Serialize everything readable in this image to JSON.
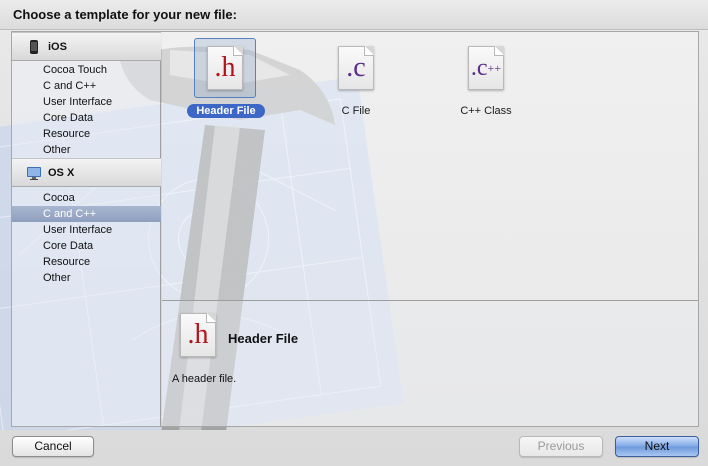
{
  "dialog": {
    "title": "Choose a template for your new file:"
  },
  "sidebar": {
    "sections": [
      {
        "label": "iOS",
        "icon": "iphone-icon",
        "items": [
          "Cocoa Touch",
          "C and C++",
          "User Interface",
          "Core Data",
          "Resource",
          "Other"
        ]
      },
      {
        "label": "OS X",
        "icon": "mac-finder-icon",
        "items": [
          "Cocoa",
          "C and C++",
          "User Interface",
          "Core Data",
          "Resource",
          "Other"
        ]
      }
    ],
    "selected": "OS X / C and C++"
  },
  "templates": [
    {
      "label": "Header File",
      "glyph": ".h",
      "glyph_color": "#b3141c",
      "selected": true
    },
    {
      "label": "C File",
      "glyph": ".c",
      "glyph_color": "#5a2d8c",
      "selected": false
    },
    {
      "label": "C++ Class",
      "glyph": ".c",
      "glyph_suffix": "++",
      "glyph_color": "#5a2d8c",
      "selected": false
    }
  ],
  "detail": {
    "title": "Header File",
    "glyph": ".h",
    "description": "A header file."
  },
  "buttons": {
    "cancel": "Cancel",
    "previous": "Previous",
    "next": "Next"
  },
  "colors": {
    "selection_blue": "#3c67c6",
    "sidebar_selected": "#8e9fbf",
    "h_glyph": "#b3141c",
    "c_glyph": "#5a2d8c"
  }
}
